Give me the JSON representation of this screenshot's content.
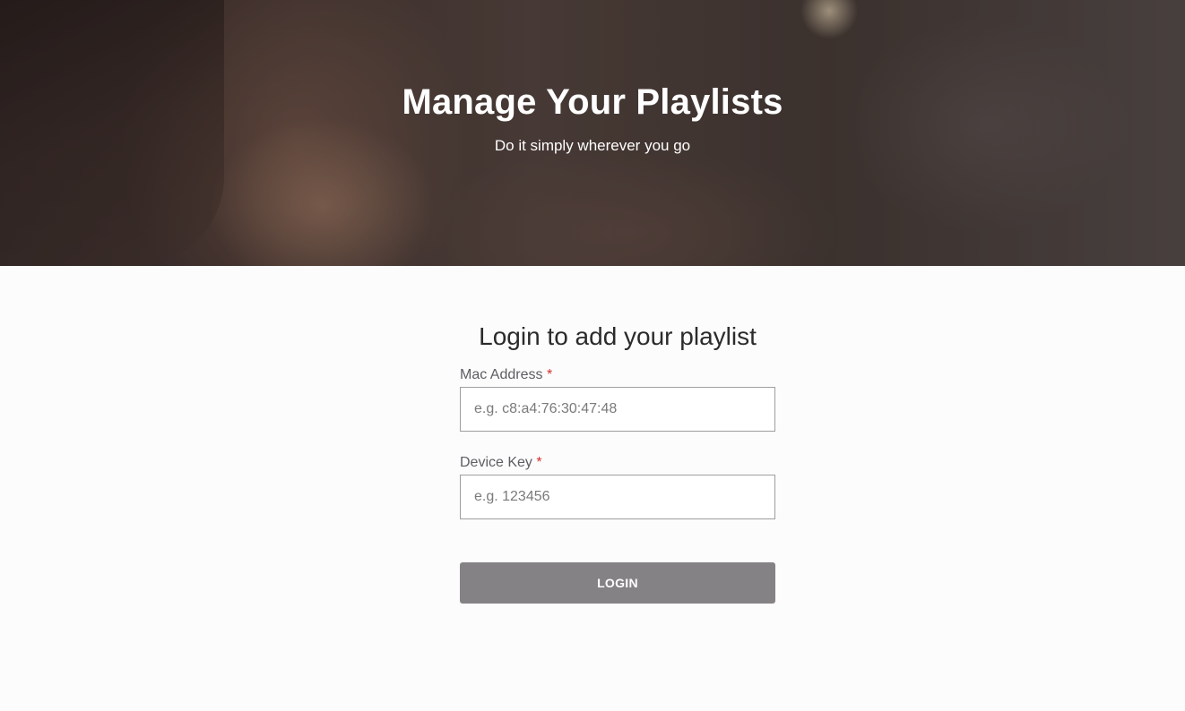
{
  "hero": {
    "title": "Manage Your Playlists",
    "subtitle": "Do it simply wherever you go"
  },
  "form": {
    "heading": "Login to add your playlist",
    "fields": [
      {
        "label": "Mac Address",
        "required_mark": "*",
        "placeholder": "e.g. c8:a4:76:30:47:48",
        "value": ""
      },
      {
        "label": "Device Key",
        "required_mark": "*",
        "placeholder": "e.g. 123456",
        "value": ""
      }
    ],
    "submit_label": "LOGIN"
  },
  "colors": {
    "button_bg": "#858285",
    "required": "#d32f2f",
    "heading": "#2b2b2b"
  }
}
